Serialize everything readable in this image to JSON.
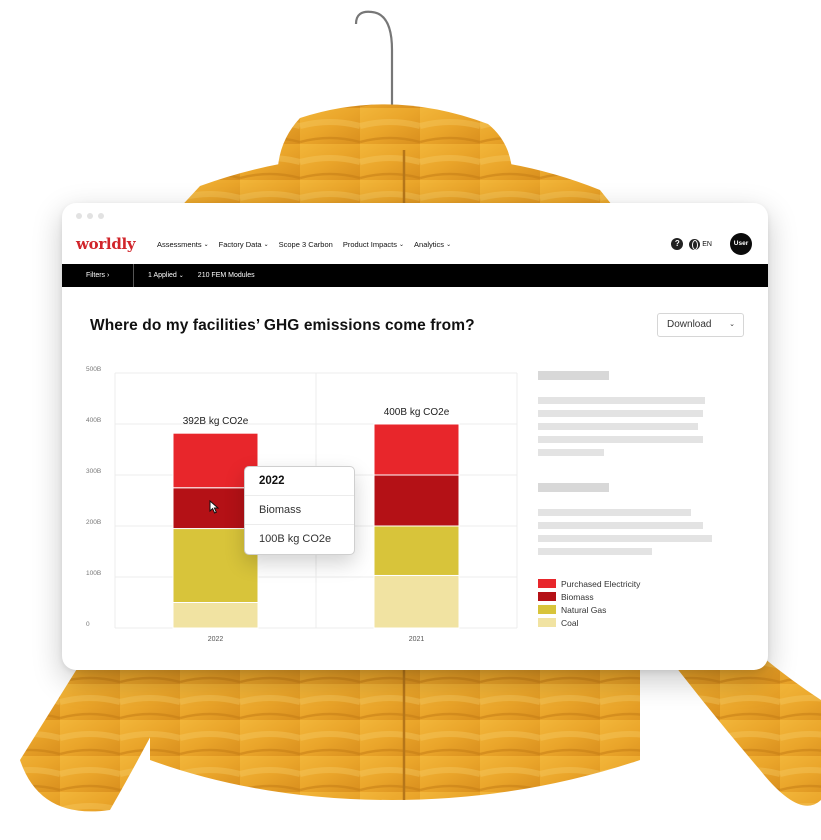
{
  "brand": {
    "logo_text": "worldly",
    "accent": "#d1252b"
  },
  "nav": {
    "menu": [
      {
        "label": "Assessments",
        "chevron": true
      },
      {
        "label": "Factory Data",
        "chevron": true
      },
      {
        "label": "Scope 3 Carbon",
        "chevron": false
      },
      {
        "label": "Product Impacts",
        "chevron": true
      },
      {
        "label": "Analytics",
        "chevron": true
      }
    ],
    "help_icon_glyph": "?",
    "language": "EN",
    "user_label": "User"
  },
  "filterbar": {
    "filters_label": "Filters",
    "filters_glyph": "›",
    "applied_label": "1 Applied",
    "modules_label": "210 FEM Modules"
  },
  "page": {
    "title": "Where do my facilities’ GHG emissions come from?",
    "download_label": "Download"
  },
  "tooltip": {
    "year": "2022",
    "category": "Biomass",
    "value": "100B kg CO2e"
  },
  "chart_data": {
    "type": "bar",
    "stacked": true,
    "categories": [
      "2022",
      "2021"
    ],
    "series": [
      {
        "name": "Coal",
        "color": "#f1e3a2",
        "values": [
          50,
          103
        ]
      },
      {
        "name": "Natural Gas",
        "color": "#d8c43a",
        "values": [
          145,
          97
        ]
      },
      {
        "name": "Biomass",
        "color": "#b41116",
        "values": [
          80,
          100
        ]
      },
      {
        "name": "Purchased Electricity",
        "color": "#e8262b",
        "values": [
          107,
          100
        ]
      }
    ],
    "totals": [
      "392B kg CO2e",
      "400B kg CO2e"
    ],
    "yticks": [
      "0",
      "100B",
      "200B",
      "300B",
      "400B",
      "500B"
    ],
    "ylim": [
      0,
      500
    ],
    "grid": true,
    "legend_position": "right"
  },
  "legend": [
    {
      "label": "Purchased Electricity",
      "color": "#e8262b"
    },
    {
      "label": "Biomass",
      "color": "#b41116"
    },
    {
      "label": "Natural Gas",
      "color": "#d8c43a"
    },
    {
      "label": "Coal",
      "color": "#f1e3a2"
    }
  ]
}
